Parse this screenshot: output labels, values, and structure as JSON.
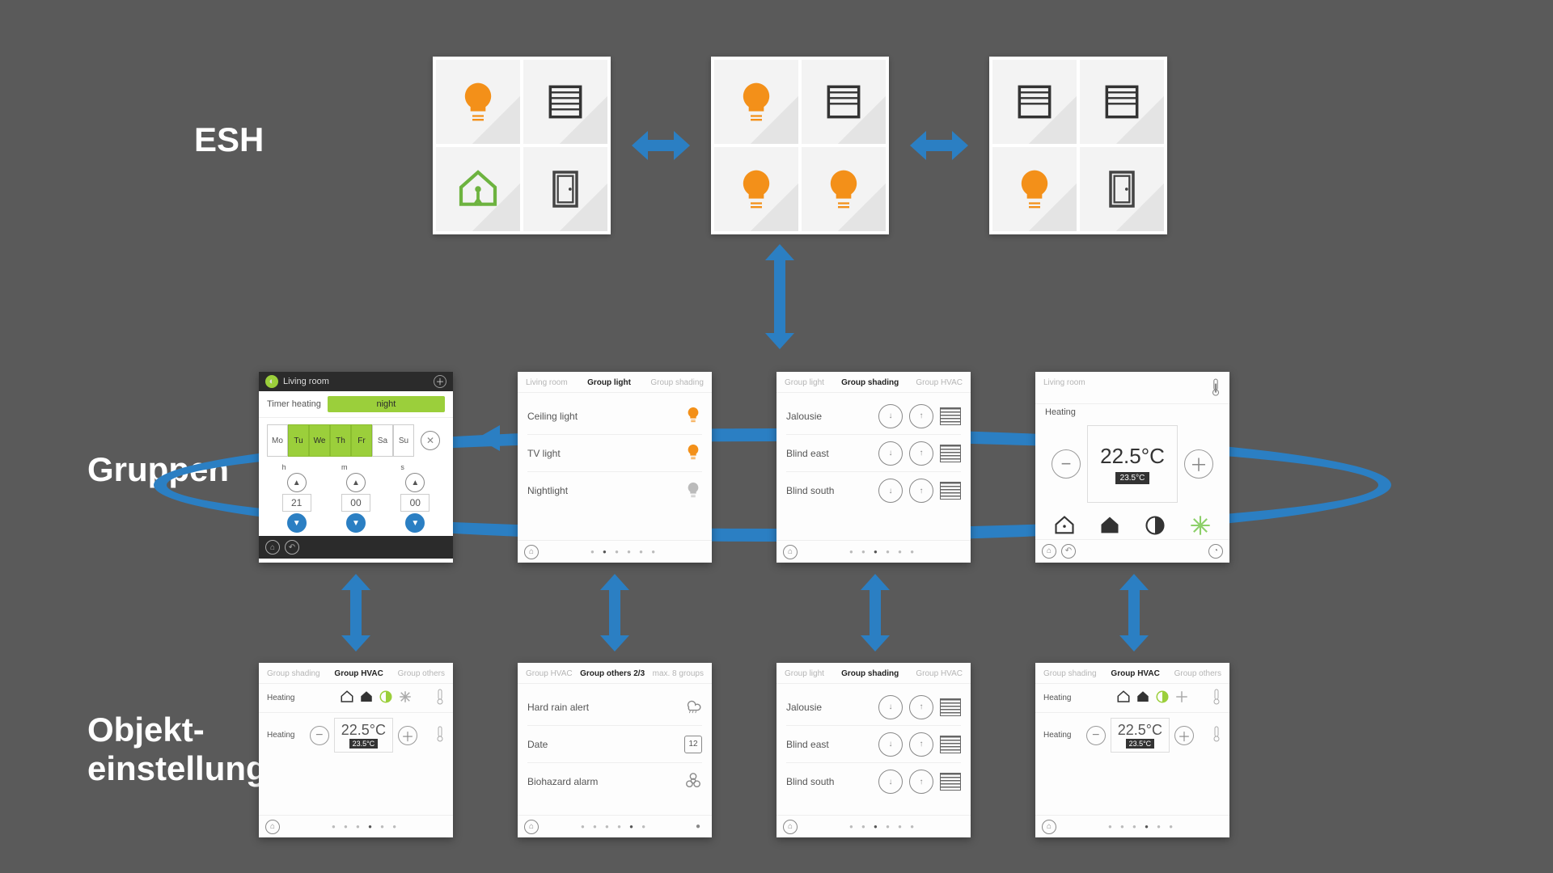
{
  "labels": {
    "esh": "ESH",
    "gruppen": "Gruppen",
    "objekt1": "Objekt-",
    "objekt2": "einstellung"
  },
  "esh_tiles": [
    [
      "bulb",
      "blind",
      "house",
      "door"
    ],
    [
      "bulb",
      "blind",
      "bulb",
      "bulb"
    ],
    [
      "blind",
      "blind",
      "bulb",
      "door"
    ]
  ],
  "gruppen_panels": {
    "timer": {
      "room": "Living room",
      "label": "Timer heating",
      "mode": "night",
      "days": [
        "Mo",
        "Tu",
        "We",
        "Th",
        "Fr",
        "Sa",
        "Su"
      ],
      "days_on": [
        false,
        true,
        true,
        true,
        true,
        false,
        false
      ],
      "h_label": "h",
      "m_label": "m",
      "s_label": "s",
      "h": "21",
      "m": "00",
      "s": "00"
    },
    "lights": {
      "crumbs": [
        "Living room",
        "Group light",
        "Group shading"
      ],
      "active": 1,
      "items": [
        {
          "name": "Ceiling light",
          "on": true
        },
        {
          "name": "TV light",
          "on": true
        },
        {
          "name": "Nightlight",
          "on": false
        }
      ]
    },
    "shading": {
      "crumbs": [
        "Group light",
        "Group shading",
        "Group HVAC"
      ],
      "active": 1,
      "items": [
        "Jalousie",
        "Blind east",
        "Blind south"
      ]
    },
    "hvac": {
      "crumbs_left": "Living room",
      "label": "Heating",
      "set": "22.5°C",
      "cur": "23.5°C"
    }
  },
  "objekt_panels": {
    "p1": {
      "crumbs": [
        "Group shading",
        "Group HVAC",
        "Group others"
      ],
      "active": 1,
      "label": "Heating",
      "set": "22.5°C",
      "cur": "23.5°C"
    },
    "p2": {
      "crumbs": [
        "Group HVAC",
        "Group others 2/3",
        "max. 8 groups"
      ],
      "active": 1,
      "items": [
        "Hard rain alert",
        "Date",
        "Biohazard alarm"
      ],
      "date": "12"
    },
    "p3": {
      "crumbs": [
        "Group light",
        "Group shading",
        "Group HVAC"
      ],
      "active": 1,
      "items": [
        "Jalousie",
        "Blind east",
        "Blind south"
      ]
    },
    "p4": {
      "crumbs": [
        "Group shading",
        "Group HVAC",
        "Group others"
      ],
      "active": 1,
      "label": "Heating",
      "set": "22.5°C",
      "cur": "23.5°C"
    }
  }
}
